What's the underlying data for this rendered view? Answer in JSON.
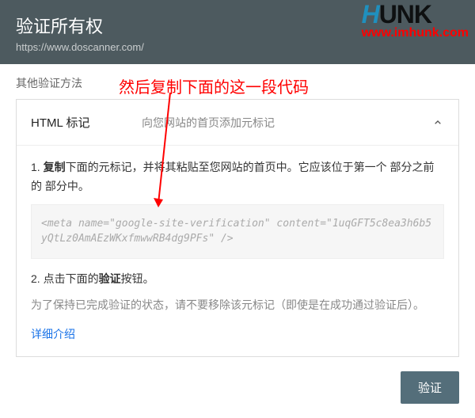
{
  "header": {
    "title": "验证所有权",
    "url": "https://www.doscanner.com/"
  },
  "logo": {
    "top_letter": "H",
    "top_rest": "UNK",
    "bottom": "www.imhunk.com"
  },
  "section_label": "其他验证方法",
  "annotation": "然后复制下面的这一段代码",
  "card": {
    "method_name": "HTML 标记",
    "method_desc": "向您网站的首页添加元标记",
    "step1_prefix": "1. ",
    "step1_bold": "复制",
    "step1_rest": "下面的元标记，并将其粘贴至您网站的首页中。它应该位于第一个 部分之前的 部分中。",
    "code": "<meta name=\"google-site-verification\" content=\"1uqGFT5c8ea3h6b5yQtLz0AmAEzWKxfmwwRB4dg9PFs\" />",
    "step2_prefix": "2. 点击下面的",
    "step2_bold": "验证",
    "step2_rest": "按钮。",
    "note": "为了保持已完成验证的状态，请不要移除该元标记（即使是在成功通过验证后）。",
    "link": "详细介绍"
  },
  "buttons": {
    "verify": "验证"
  }
}
